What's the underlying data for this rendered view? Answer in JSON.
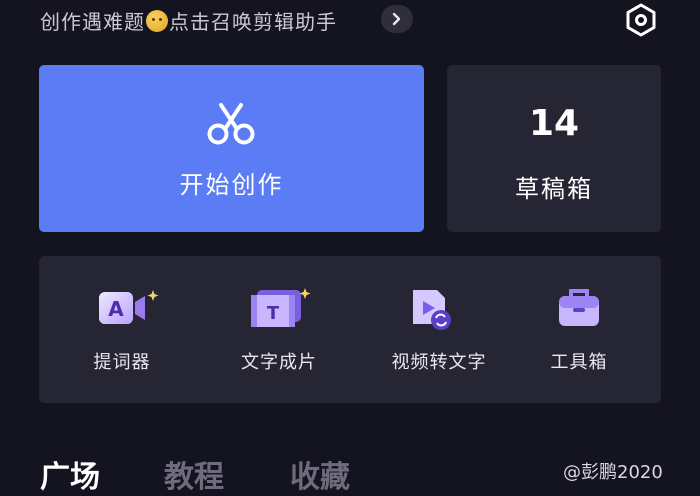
{
  "header": {
    "help_text_before": "创作遇难题",
    "help_text_after": "点击召唤剪辑助手",
    "emoji_icon": "thinking-face-icon",
    "chevron_icon": "chevron-right-icon",
    "settings_icon": "hexagon-settings-icon"
  },
  "create_card": {
    "label": "开始创作",
    "icon": "scissors-icon",
    "color": "#5b7cf5"
  },
  "drafts_card": {
    "count": "14",
    "label": "草稿箱"
  },
  "tools": [
    {
      "label": "提词器",
      "icon": "teleprompter-icon"
    },
    {
      "label": "文字成片",
      "icon": "text-to-video-icon"
    },
    {
      "label": "视频转文字",
      "icon": "video-to-text-icon"
    },
    {
      "label": "工具箱",
      "icon": "toolbox-icon"
    }
  ],
  "bottom_tabs": [
    {
      "label": "广场",
      "active": true
    },
    {
      "label": "教程",
      "active": false
    },
    {
      "label": "收藏",
      "active": false
    }
  ],
  "watermark": "@彭鹏2020"
}
